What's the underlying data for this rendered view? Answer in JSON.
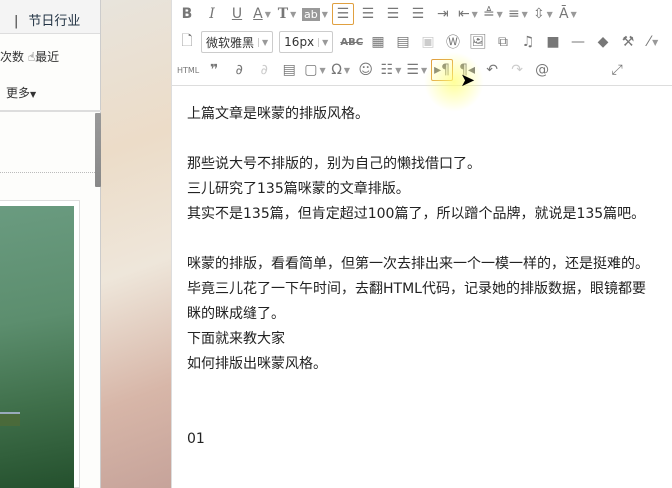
{
  "left_panel": {
    "tab": "节日行业",
    "row1_a": "次数",
    "row1_b": "最近",
    "more": "更多"
  },
  "toolbar": {
    "row1": [
      "B",
      "I",
      "U",
      "A",
      "T",
      "ab",
      "align-left",
      "align-center",
      "align-right",
      "justify",
      "indent",
      "outdent",
      "spacing-top",
      "spacing-bottom",
      "line-height",
      "font-case"
    ],
    "font_family": "微软雅黑",
    "font_size": "16px",
    "spellcheck": "ABC",
    "html": "HTML",
    "omega": "Ω"
  },
  "content": {
    "lines": [
      "上篇文章是咪蒙的排版风格。",
      "",
      "那些说大号不排版的，别为自己的懒找借口了。",
      "三儿研究了135篇咪蒙的文章排版。",
      "其实不是135篇，但肯定超过100篇了，所以蹭个品牌，就说是135篇吧。",
      "",
      "咪蒙的排版，看看简单，但第一次去排出来一个一模一样的，还是挺难的。",
      "毕竟三儿花了一下午时间，去翻HTML代码，记录她的排版数据，眼镜都要眯的眯成缝了。",
      "下面就来教大家",
      "如何排版出咪蒙风格。",
      "",
      "",
      "01"
    ]
  }
}
